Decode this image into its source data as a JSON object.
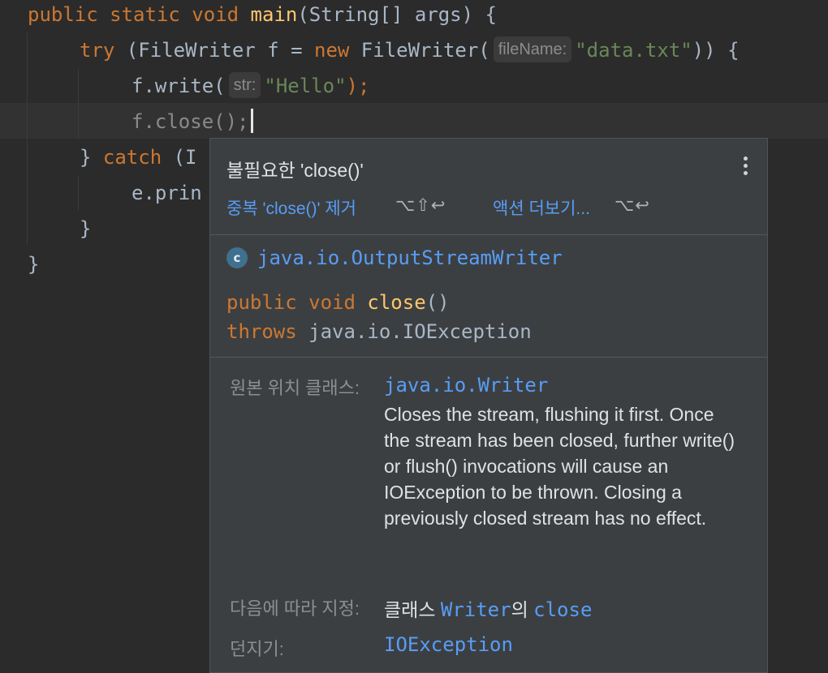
{
  "editor": {
    "lines": {
      "l1": {
        "kw1": "public static void ",
        "fn": "main",
        "rest": "(String[] args) {"
      },
      "l2": {
        "kw": "try",
        "mid": " (FileWriter f = ",
        "kw2": "new",
        "cls": " FileWriter(",
        "hint": "fileName:",
        "str": "\"data.txt\"",
        "end": ")) {"
      },
      "l3": {
        "pre": "f.write(",
        "hint": "str:",
        "str": "\"Hello\"",
        "end": ");"
      },
      "l4": {
        "code": "f.close();"
      },
      "l5": {
        "brace": "} ",
        "kw": "catch",
        "rest": " (I"
      },
      "l6": {
        "code": "e.prin"
      },
      "l7": {
        "code": "}"
      },
      "l8": {
        "code": "}"
      }
    }
  },
  "popup": {
    "title": "불필요한 'close()'",
    "action1": "중복 'close()' 제거",
    "action1_shortcut": "⌥⇧↩",
    "action2": "액션 더보기...",
    "action2_shortcut": "⌥↩",
    "class_icon_letter": "c",
    "class_name": "java.io.OutputStreamWriter",
    "signature": {
      "kw1": "public void ",
      "fn": "close",
      "paren": "()",
      "kw2": "throws",
      "exc": " java.io.IOException"
    },
    "original_label": "원본 위치 클래스:",
    "original_value": "java.io.Writer",
    "description": "Closes the stream, flushing it first. Once the stream has been closed, further write() or flush() invocations will cause an IOException to be thrown. Closing a previously closed stream has no effect.",
    "specified_label": "다음에 따라 지정:",
    "specified_prefix": "클래스 ",
    "specified_class": "Writer",
    "specified_mid": "의 ",
    "specified_method": "close",
    "throws_label": "던지기:",
    "throws_value": "IOException"
  },
  "colors": {
    "background": "#2b2b2b",
    "keyword": "#cc7832",
    "function": "#ffc66d",
    "string": "#6a8759",
    "link": "#589df6",
    "popup_bg": "#3c3f41"
  },
  "icons": [
    "class-c-icon",
    "more-vertical-icon"
  ]
}
